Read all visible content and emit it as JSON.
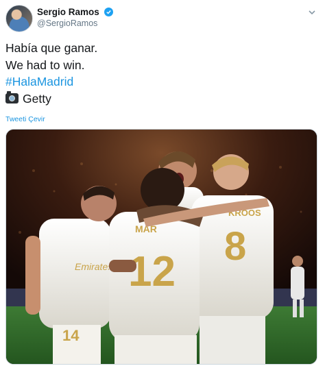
{
  "author": {
    "display_name": "Sergio Ramos",
    "handle": "@SergioRamos",
    "verified_icon": "verified-badge-icon"
  },
  "tweet": {
    "lines": [
      "Había que ganar.",
      "We had to win."
    ],
    "hashtag": "#HalaMadrid",
    "credit": "Getty"
  },
  "translate_link": "Tweeti Çevir",
  "photo": {
    "jersey_numbers": [
      "12",
      "8",
      "14"
    ],
    "jersey_names": [
      "MAR",
      "KROOS"
    ],
    "sponsor": "Emirates"
  },
  "colors": {
    "link": "#1b95e0",
    "verified": "#1da1f2",
    "pitch": "#2f6b2a",
    "kit": "#f2f0ea",
    "gold": "#c9a44a"
  }
}
